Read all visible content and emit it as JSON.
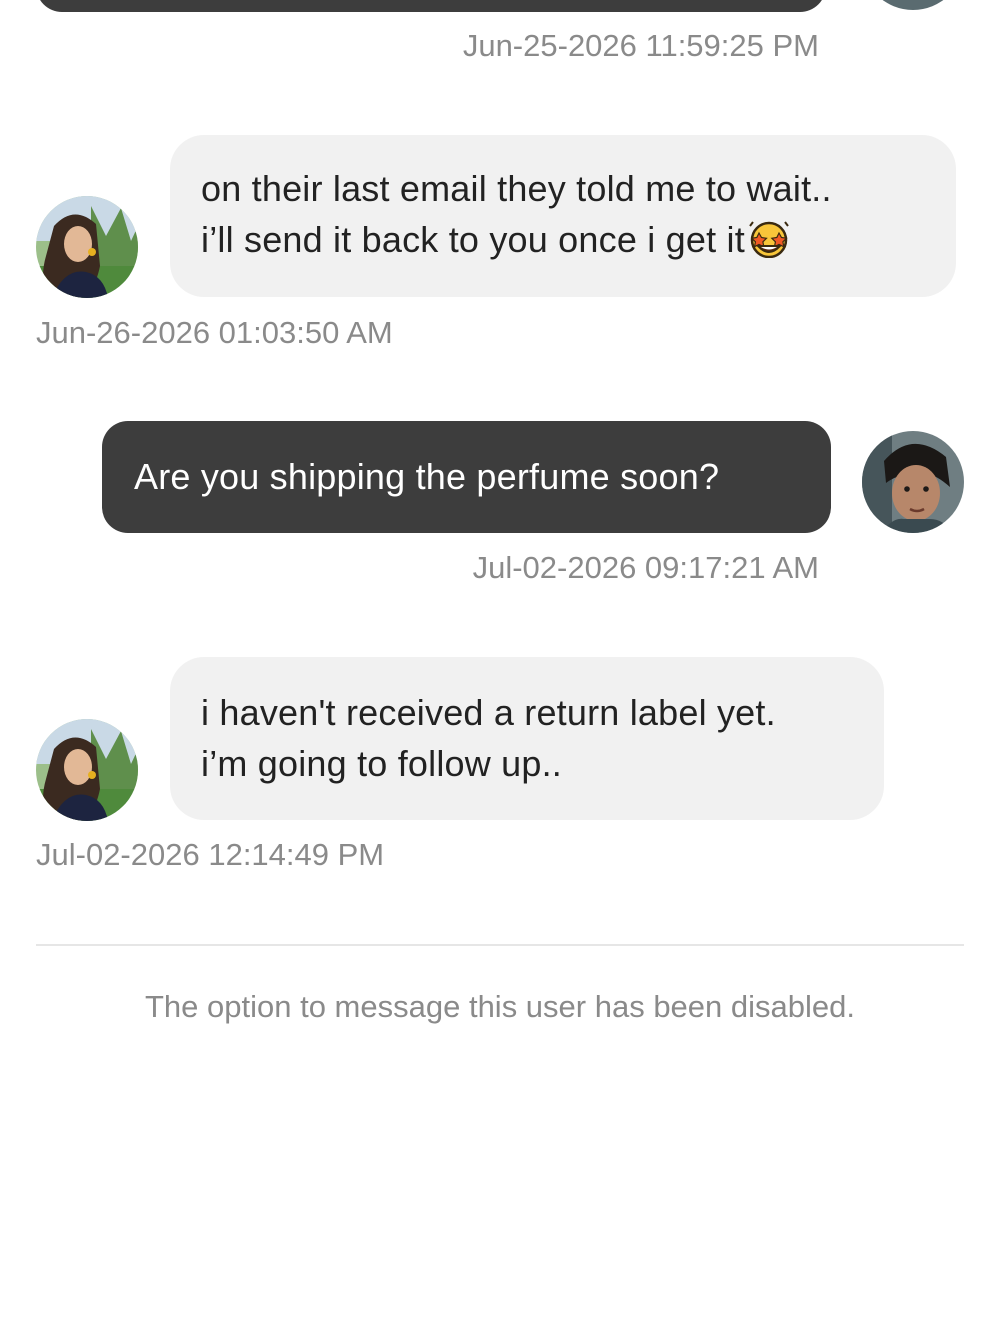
{
  "conversation": {
    "messages": [
      {
        "direction": "outgoing",
        "lines": [],
        "timestamp": "Jun-25-2026 11:59:25 PM",
        "avatar": "user-avatar-self"
      },
      {
        "direction": "incoming",
        "lines": [
          "on their last email they told me to wait..",
          "i’ll send it back to you once i get it"
        ],
        "emoji": "star-struck-emoji",
        "timestamp": "Jun-26-2026 01:03:50 AM",
        "avatar": "user-avatar-other"
      },
      {
        "direction": "outgoing",
        "lines": [
          "Are you shipping the perfume soon?"
        ],
        "timestamp": "Jul-02-2026 09:17:21 AM",
        "avatar": "user-avatar-self"
      },
      {
        "direction": "incoming",
        "lines": [
          "i haven't received a return label yet.",
          "i’m going to follow up.."
        ],
        "timestamp": "Jul-02-2026 12:14:49 PM",
        "avatar": "user-avatar-other"
      }
    ]
  },
  "footer": {
    "disabled_notice": "The option to message this user has been disabled."
  },
  "colors": {
    "incoming_bubble": "#f1f1f1",
    "outgoing_bubble": "#3d3d3d",
    "timestamp_text": "#8a8a8a",
    "divider": "#e6e6e6"
  }
}
